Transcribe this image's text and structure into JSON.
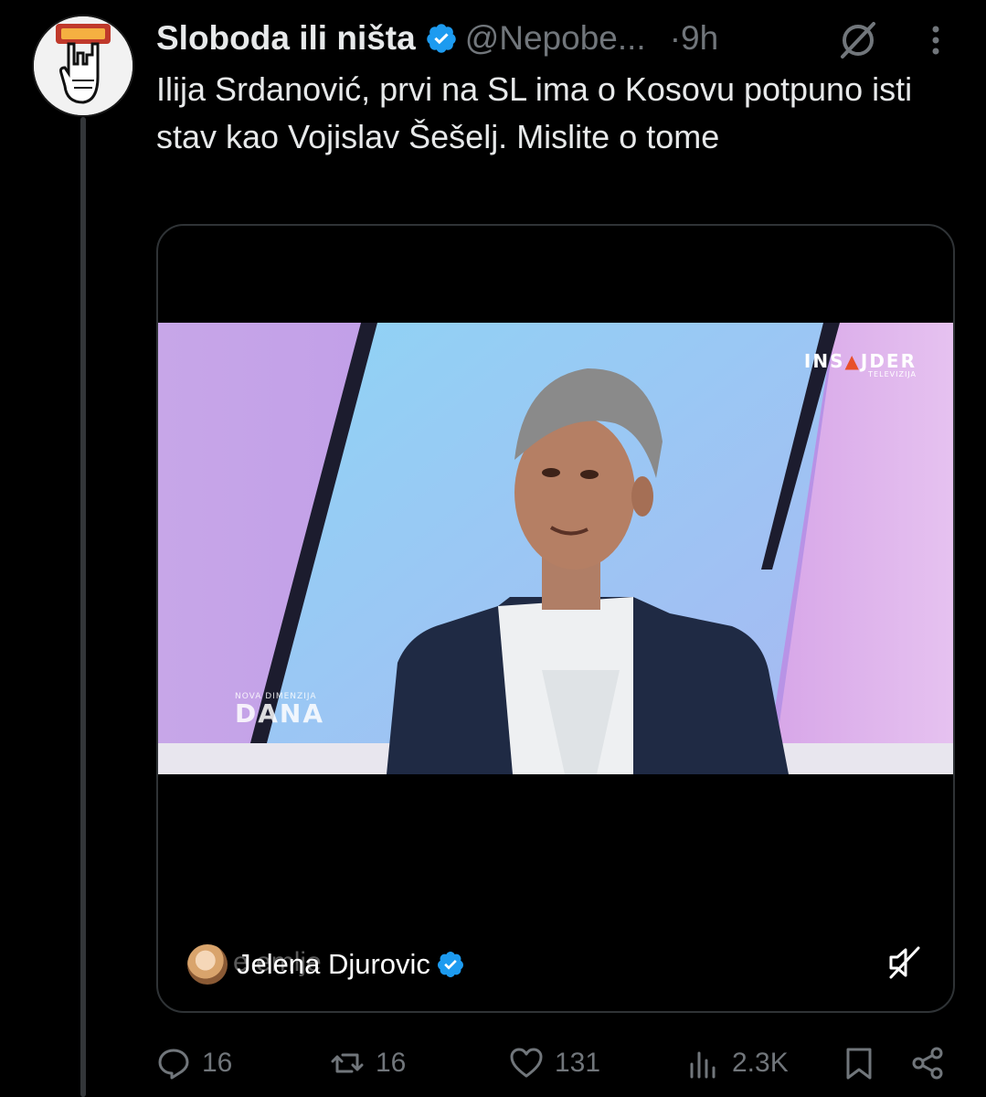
{
  "tweet": {
    "display_name": "Sloboda ili ništa",
    "handle": "@Nepobe...",
    "time": "·9h",
    "text": "Ilija Srdanović, prvi na SL ima o Kosovu potpuno isti stav kao Vojislav Šešelj. Mislite o tome",
    "avatar_icon": "rock-hand-avatar-icon",
    "verified_color": "#1d9bf0"
  },
  "media": {
    "channel_logo_main_a": "INS",
    "channel_logo_main_b": "JDER",
    "channel_logo_sub": "TELEVIZIJA",
    "show_logo_small": "NOVA DIMENZIJA",
    "show_logo_big": "DANA",
    "quoted_user": "Jelena Djurovic",
    "overlay_text_partial": "e  emlje"
  },
  "actions": {
    "replies": "16",
    "reposts": "16",
    "likes": "131",
    "views": "2.3K"
  },
  "colors": {
    "background": "#000000",
    "text": "#e7e9ea",
    "muted": "#71767b",
    "border": "#2f3336",
    "accent": "#1d9bf0"
  }
}
